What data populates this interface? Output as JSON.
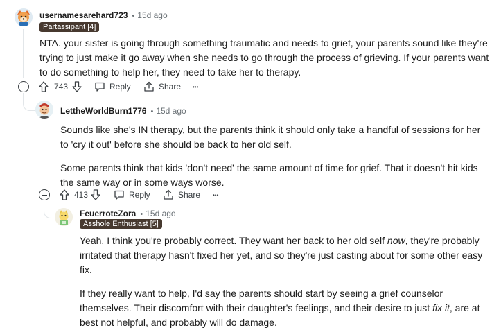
{
  "comments": [
    {
      "username": "usernamesarehard723",
      "sep": "•",
      "time": "15d ago",
      "flair": "Partassipant [4]",
      "body": [
        "NTA. your sister is going through something traumatic and needs to grief, your parents sound like they're trying to just make it go away when she needs to go through the process of grieving. If your parents want to do something to help her, they need to take her to therapy."
      ],
      "votes": "743",
      "reply_label": "Reply",
      "share_label": "Share",
      "more_label": "•••"
    },
    {
      "username": "LettheWorldBurn1776",
      "sep": "•",
      "time": "15d ago",
      "body": [
        "Sounds like she's IN therapy, but the parents think it should only take a handful of sessions for her to 'cry it out' before she should be back to her old self.",
        "Some parents think that kids 'don't need' the same amount of time for grief. That it doesn't hit kids the same way or in some ways worse."
      ],
      "votes": "413",
      "reply_label": "Reply",
      "share_label": "Share",
      "more_label": "•••"
    },
    {
      "username": "FeuerroteZora",
      "sep": "•",
      "time": "15d ago",
      "flair": "Asshole Enthusiast [5]",
      "body_p1": {
        "a": "Yeah, I think you're probably correct. They want her back to her old self ",
        "em": "now",
        "b": ", they're probably irritated that therapy hasn't fixed her yet, and so they're just casting about for some other easy fix."
      },
      "body_p2": {
        "a": "If they really want to help, I'd say the parents should start by seeing a grief counselor themselves. Their discomfort with their daughter's feelings, and their desire to just ",
        "em": "fix it",
        "b": ", are at best not helpful, and probably will do damage."
      }
    }
  ],
  "icons": [
    "avatar-dog",
    "avatar-burn",
    "avatar-zora",
    "upvote-icon",
    "downvote-icon",
    "reply-icon",
    "share-icon",
    "collapse-icon"
  ],
  "colors": {
    "flair_bg": "#47392f",
    "thread_line": "#e2e6e9",
    "text": "#1c1c1c",
    "meta": "#6a7176"
  }
}
